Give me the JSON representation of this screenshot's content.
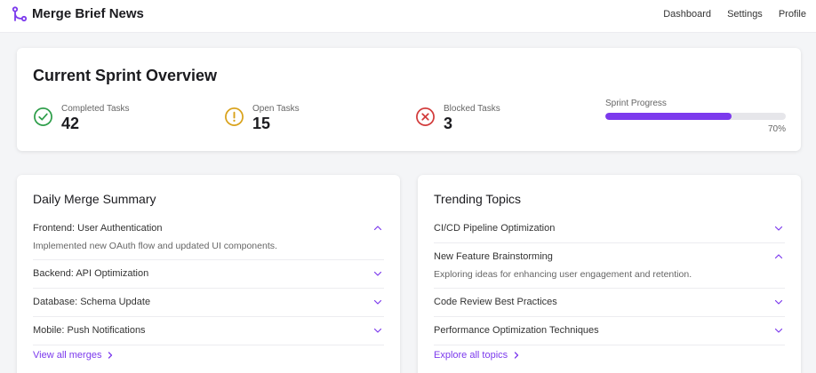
{
  "app": {
    "title": "Merge Brief News"
  },
  "nav": {
    "items": [
      "Dashboard",
      "Settings",
      "Profile"
    ]
  },
  "overview": {
    "title": "Current Sprint Overview",
    "stats": [
      {
        "label": "Completed Tasks",
        "value": "42",
        "icon": "check-circle-icon",
        "color": "#2e9e4a"
      },
      {
        "label": "Open Tasks",
        "value": "15",
        "icon": "alert-circle-icon",
        "color": "#d9a21b"
      },
      {
        "label": "Blocked Tasks",
        "value": "3",
        "icon": "x-circle-icon",
        "color": "#d23b3b"
      }
    ],
    "progress": {
      "label": "Sprint Progress",
      "percent_text": "70%",
      "value": 0.7,
      "color": "#7c3aed"
    }
  },
  "merges": {
    "title": "Daily Merge Summary",
    "items": [
      {
        "label": "Frontend: User Authentication",
        "expanded": true,
        "detail": "Implemented new OAuth flow and updated UI components."
      },
      {
        "label": "Backend: API Optimization",
        "expanded": false
      },
      {
        "label": "Database: Schema Update",
        "expanded": false
      },
      {
        "label": "Mobile: Push Notifications",
        "expanded": false
      }
    ],
    "link": "View all merges"
  },
  "topics": {
    "title": "Trending Topics",
    "items": [
      {
        "label": "CI/CD Pipeline Optimization",
        "expanded": false
      },
      {
        "label": "New Feature Brainstorming",
        "expanded": true,
        "detail": "Exploring ideas for enhancing user engagement and retention."
      },
      {
        "label": "Code Review Best Practices",
        "expanded": false
      },
      {
        "label": "Performance Optimization Techniques",
        "expanded": false
      }
    ],
    "link": "Explore all topics"
  }
}
